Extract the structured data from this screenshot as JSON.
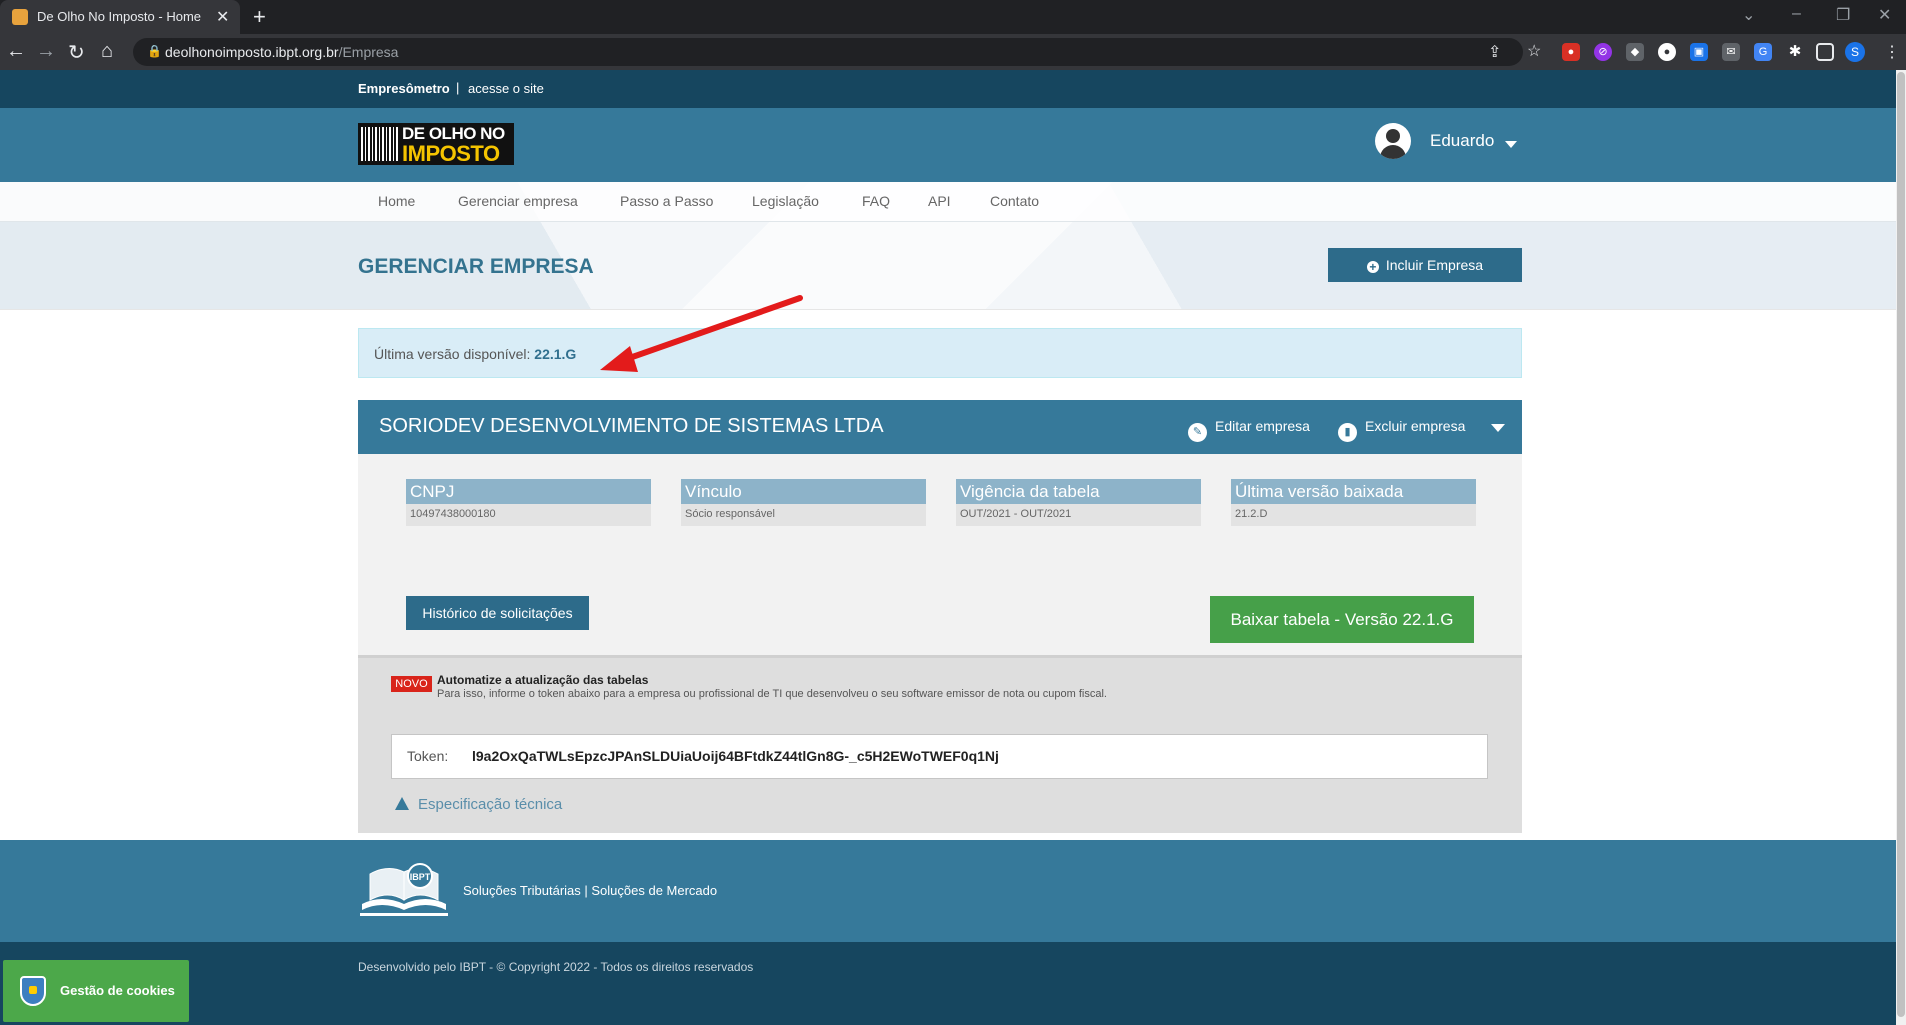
{
  "browser": {
    "tab_title": "De Olho No Imposto - Home",
    "url_host": "deolhonoimposto.ibpt.org.br",
    "url_path": "/Empresa",
    "profile_initial": "S"
  },
  "topbar": {
    "brand": "Empresômetro",
    "separator": "|",
    "site_link": "acesse o site"
  },
  "header": {
    "logo_line1": "DE OLHO NO",
    "logo_line2": "IMPOSTO",
    "username": "Eduardo"
  },
  "menu": {
    "items": [
      "Home",
      "Gerenciar empresa",
      "Passo a Passo",
      "Legislação",
      "FAQ",
      "API",
      "Contato"
    ]
  },
  "page": {
    "title": "GERENCIAR EMPRESA",
    "add_button": "Incluir Empresa"
  },
  "alert": {
    "label": "Última versão disponível: ",
    "version": "22.1.G"
  },
  "company": {
    "name": "SORIODEV DESENVOLVIMENTO DE SISTEMAS LTDA",
    "edit_label": "Editar empresa",
    "delete_label": "Excluir empresa",
    "fields": [
      {
        "label": "CNPJ",
        "value": "10497438000180"
      },
      {
        "label": "Vínculo",
        "value": "Sócio responsável"
      },
      {
        "label": "Vigência da tabela",
        "value": "OUT/2021 - OUT/2021"
      },
      {
        "label": "Última versão baixada",
        "value": "21.2.D"
      }
    ],
    "history_button": "Histórico de solicitações",
    "download_button": "Baixar tabela - Versão 22.1.G"
  },
  "automation": {
    "badge": "NOVO",
    "title": "Automatize a atualização das tabelas",
    "description": "Para isso, informe o token abaixo para a empresa ou profissional de TI que desenvolveu o seu software emissor de nota ou cupom fiscal.",
    "token_label": "Token:",
    "token_value": "l9a2OxQaTWLsEpzcJPAnSLDUiaUoij64BFtdkZ44tlGn8G-_c5H2EWoTWEF0q1Nj",
    "spec_link": "Especificação técnica"
  },
  "footer": {
    "logo_text": "IBPT",
    "links": "Soluções Tributárias | Soluções de Mercado",
    "copyright": "Desenvolvido pelo IBPT - © Copyright 2022 - Todos os direitos reservados"
  },
  "cookies": {
    "label": "Gestão de cookies"
  },
  "colors": {
    "primary": "#36799a",
    "dark": "#16465f",
    "success": "#46a049",
    "alert_bg": "#d9edf7",
    "arrow": "#e31b1b"
  }
}
